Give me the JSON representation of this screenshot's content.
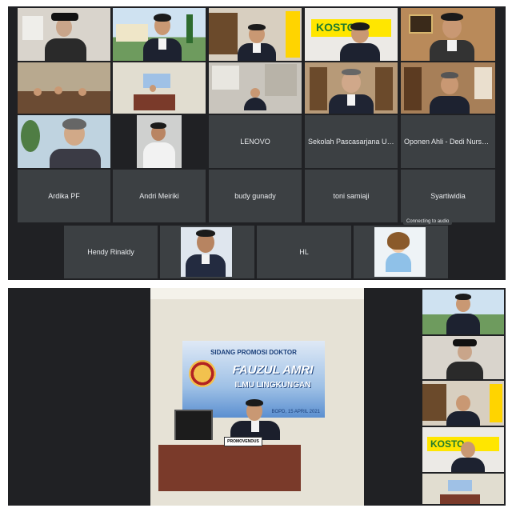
{
  "top_grid": {
    "toast": "Connecting to audio",
    "name_tiles": {
      "lenovo": "LENOVO",
      "pascasarjana": "Sekolah Pascasarjana Unpad",
      "oponen": "Oponen Ahli - Dedi Nursya...",
      "ardika": "Ardika PF",
      "andri": "Andri Meiriki",
      "budy": "budy gunady",
      "toni": "toni samiaji",
      "syartiwidia": "Syartiwidia",
      "hendy": "Hendy Rinaldy",
      "hl": "HL"
    },
    "kosto_sign": "KOSTO"
  },
  "bottom_stage": {
    "banner_title": "SIDANG PROMOSI DOKTOR",
    "banner_name": "FAUZUL AMRI",
    "banner_field": "ILMU LINGKUNGAN",
    "banner_date": "BOPD, 15 APRIL 2021",
    "nameplate": "PROMOVENDUS",
    "side_kosto_sign": "KOSTO"
  },
  "colors": {
    "meet_dark": "#202124",
    "tile_gray": "#3c4043",
    "tile_text": "#e8eaed"
  }
}
